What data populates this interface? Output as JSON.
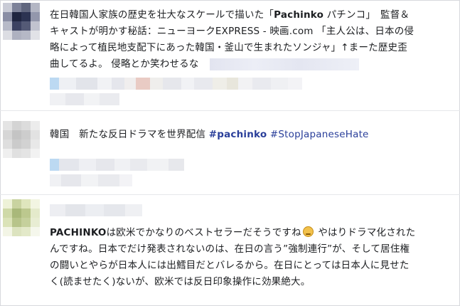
{
  "posts": [
    {
      "text_line1_a": "在日韓国人家族の歴史を壮大なスケールで描いた「",
      "text_line1_bold": "Pachinko",
      "text_line1_b": " パチンコ」　監督＆",
      "text_line2": "キャストが明かす秘話：ニューヨークEXPRESS - 映画.com 「主人公は、日本の侵",
      "text_line3": "略によって植民地支配下にあった韓国・釜山で生まれたソンジャ」↑まーた歴史歪",
      "text_line4": "曲してるよ。 侵略とか笑わせるな"
    },
    {
      "text_plain": "韓国　新たな反日ドラマを世界配信 ",
      "hashtag1": "#pachinko",
      "hashtag2": "#StopJapaneseHate"
    },
    {
      "line1_bold": "PACHINKO",
      "line1_rest": "は欧米でかなりのベストセラーだそうですね",
      "line1_end": " やはりドラマ化された",
      "line2": "んですね。日本でだけ発表されないのは、在日の言う”強制連行”が、そして居住権",
      "line3": "の闘いとやらが日本人には出鱈目だとバレるから。在日にとっては日本人に見せた",
      "line4": "く(読ませたく)ないが、欧米では反日印象操作に効果絶大。"
    }
  ],
  "icons": {
    "emoji_post3": "sleepy-face-icon"
  },
  "colors": {
    "text": "#1c1e21",
    "hashtag": "#2a3f9a",
    "divider": "#e6e7ea",
    "emoji": "#f2c14b"
  }
}
